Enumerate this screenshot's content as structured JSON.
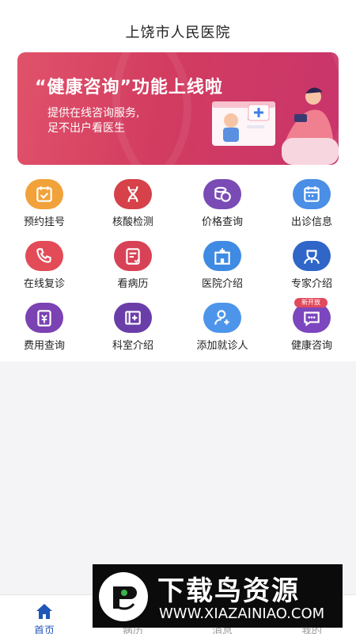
{
  "header": {
    "title": "上饶市人民医院"
  },
  "banner": {
    "headline": "“健康咨询”功能上线啦",
    "line1": "提供在线咨询服务,",
    "line2": "足不出户看医生"
  },
  "grid": [
    {
      "label": "预约挂号",
      "icon": "calendar-check-icon",
      "color": "#f1a23a"
    },
    {
      "label": "核酸检测",
      "icon": "dna-icon",
      "color": "#d6414a"
    },
    {
      "label": "价格查询",
      "icon": "coins-icon",
      "color": "#7a4bb5"
    },
    {
      "label": "出诊信息",
      "icon": "calendar-icon",
      "color": "#4a8ee6"
    },
    {
      "label": "在线复诊",
      "icon": "phone-icon",
      "color": "#e24b57"
    },
    {
      "label": "看病历",
      "icon": "medical-record-icon",
      "color": "#d84256"
    },
    {
      "label": "医院介绍",
      "icon": "hospital-icon",
      "color": "#3f8ae3"
    },
    {
      "label": "专家介绍",
      "icon": "doctor-icon",
      "color": "#2f66c8"
    },
    {
      "label": "费用查询",
      "icon": "bill-icon",
      "color": "#7a42b2"
    },
    {
      "label": "科室介绍",
      "icon": "department-icon",
      "color": "#6a3ea8"
    },
    {
      "label": "添加就诊人",
      "icon": "add-user-icon",
      "color": "#4c95ea"
    },
    {
      "label": "健康咨询",
      "icon": "chat-icon",
      "color": "#7c46be"
    }
  ],
  "badge": {
    "text": "新开放"
  },
  "tabbar": [
    {
      "label": "首页",
      "icon": "home-icon",
      "active": true
    },
    {
      "label": "病历",
      "icon": "record-icon",
      "active": false
    },
    {
      "label": "消息",
      "icon": "message-icon",
      "active": false
    },
    {
      "label": "我的",
      "icon": "profile-icon",
      "active": false
    }
  ],
  "watermark": {
    "title": "下载鸟资源",
    "url": "WWW.XIAZAINIAO.COM"
  },
  "colors": {
    "accent": "#1f56b8",
    "banner": "#d23c60",
    "badge": "#e14a5c"
  }
}
